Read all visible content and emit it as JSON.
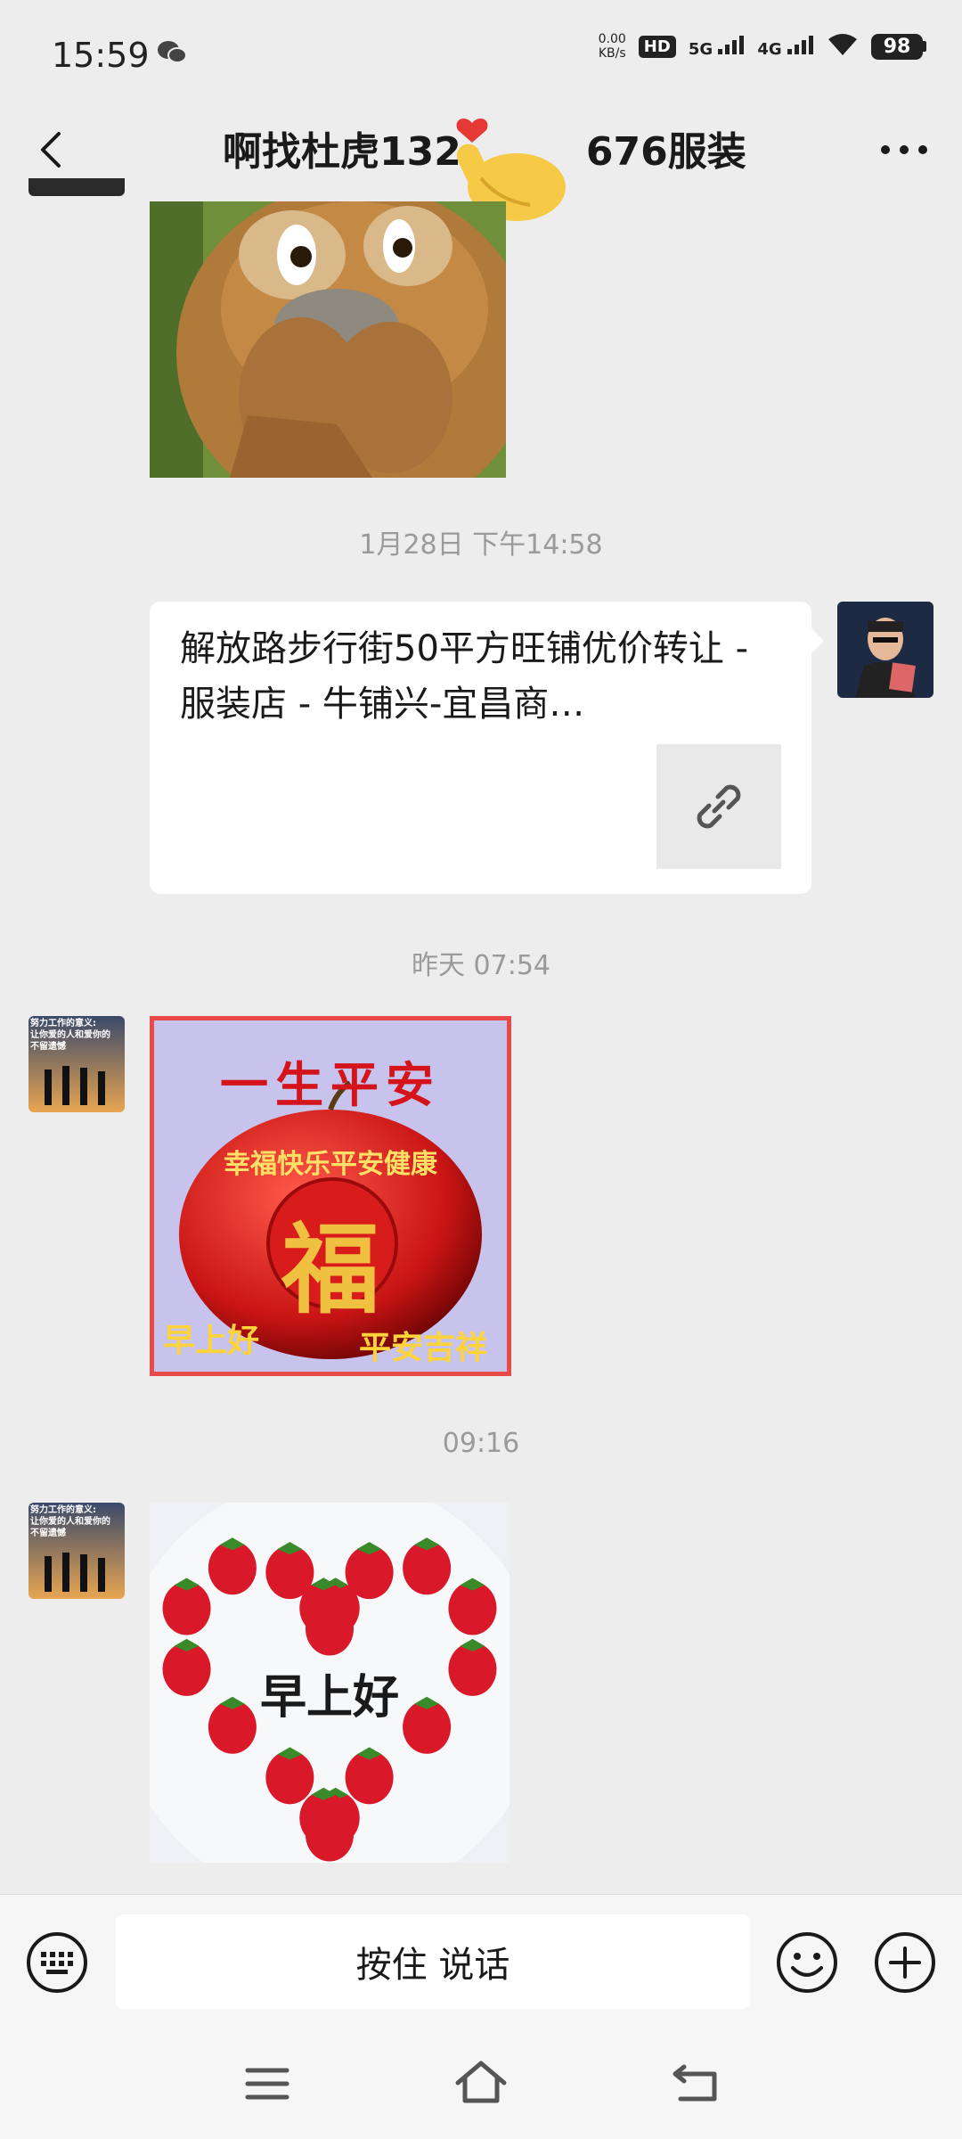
{
  "status": {
    "time": "15:59",
    "speed_value": "0.00",
    "speed_unit": "KB/s",
    "hd": "HD",
    "sim1": "5G",
    "sim2": "4G",
    "battery": "98"
  },
  "header": {
    "title_prefix": "啊找杜虎132",
    "title_suffix": "676服装",
    "back_icon": "chevron-left-icon",
    "more_icon": "more-dots-icon"
  },
  "messages": [
    {
      "type": "image",
      "side": "left",
      "image": "cartoon-bear-sticker"
    },
    {
      "type": "time",
      "text": "1月28日 下午14:58"
    },
    {
      "type": "link",
      "side": "right",
      "title": "解放路步行街50平方旺铺优价转让 - 服装店 - 牛铺兴-宜昌商…",
      "icon": "link-icon"
    },
    {
      "type": "time",
      "text": "昨天 07:54"
    },
    {
      "type": "image",
      "side": "left",
      "image": "apple-blessing-card",
      "texts": {
        "top": "一生平安",
        "middle": "幸福快乐平安健康",
        "center": "福",
        "bottom_left": "早上好",
        "bottom_right": "平安吉祥"
      }
    },
    {
      "type": "time",
      "text": "09:16"
    },
    {
      "type": "image",
      "side": "left",
      "image": "strawberry-heart",
      "texts": {
        "center": "早上好"
      }
    }
  ],
  "avatar_text": {
    "line1": "努力工作的意义:",
    "line2": "让你爱的人和爱你的",
    "line3": "不留遗憾"
  },
  "input_bar": {
    "voice_label": "按住 说话",
    "keyboard_icon": "keyboard-icon",
    "emoji_icon": "emoji-icon",
    "plus_icon": "plus-icon"
  },
  "colors": {
    "background": "#ededed",
    "bubble": "#ffffff",
    "timestamp": "#9a9a9a",
    "card_border": "#e84a4a"
  }
}
